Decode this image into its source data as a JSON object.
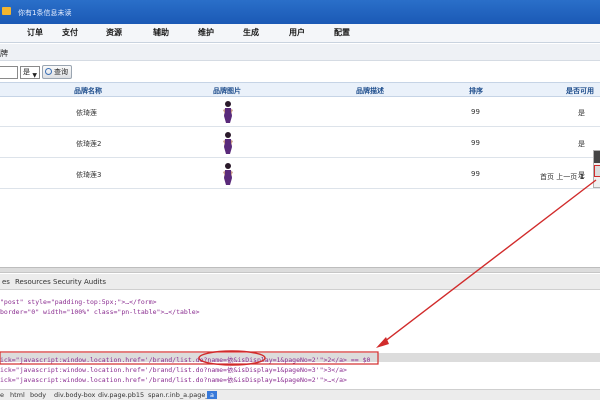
{
  "topbar": {
    "message": "你有1条信息未读"
  },
  "menu": [
    "订单",
    "支付",
    "资源",
    "辅助",
    "维护",
    "生成",
    "用户",
    "配置"
  ],
  "breadcrumb": "牌",
  "filter": {
    "select_value": "是",
    "query_label": "查询"
  },
  "table": {
    "headers": [
      "品牌名称",
      "品牌图片",
      "品牌描述",
      "排序",
      "是否可用"
    ],
    "rows": [
      {
        "name": "依琦莲",
        "desc": "",
        "sort": "99",
        "available": "是"
      },
      {
        "name": "依琦莲2",
        "desc": "",
        "sort": "99",
        "available": "是"
      },
      {
        "name": "依琦莲3",
        "desc": "",
        "sort": "99",
        "available": "是"
      }
    ]
  },
  "pager": {
    "first": "首页",
    "prev": "上一页",
    "current": "1"
  },
  "devtools": {
    "tabs": [
      "es",
      "Resources",
      "Security",
      "Audits"
    ],
    "lines": [
      "\"post\" style=\"padding-top:5px;\">…</form>",
      " border=\"0\" width=\"100%\" class=\"pn-ltable\">…</table>",
      "ick=\"javascript:window.location.href='/brand/list.do?name=依&isDisplay=1&pageNo=2'\">2</a> == $0",
      "ick=\"javascript:window.location.href='/brand/list.do?name=依&isDisplay=1&pageNo=3'\">3</a>",
      "ick=\"javascript:window.location.href='/brand/list.do?name=依&isDisplay=1&pageNo=2'\">…</a>"
    ],
    "breadcrumbs": [
      "e",
      "html",
      "body",
      "div.body-box",
      "div.page.pb15",
      "span.r.inb_a.page_b",
      "a"
    ]
  },
  "colors": {
    "topbar": "#1b59b5",
    "annotation": "#d12b2b",
    "header_text": "#1e4d8c"
  }
}
